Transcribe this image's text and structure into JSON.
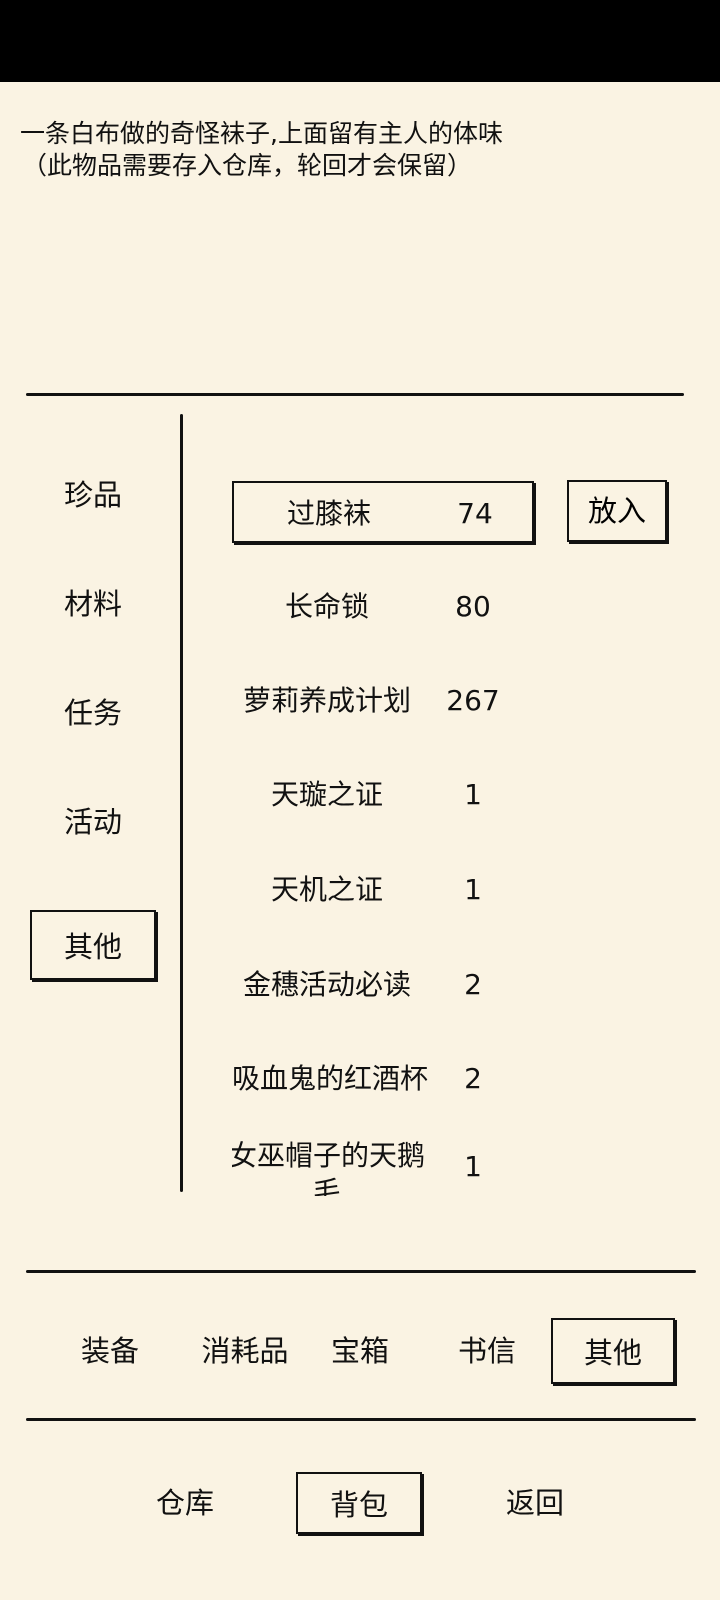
{
  "description": {
    "line1": "一条白布做的奇怪袜子,上面留有主人的体味",
    "line2": "（此物品需要存入仓库，轮回才会保留）"
  },
  "categories": [
    {
      "label": "珍品",
      "selected": false
    },
    {
      "label": "材料",
      "selected": false
    },
    {
      "label": "任务",
      "selected": false
    },
    {
      "label": "活动",
      "selected": false
    },
    {
      "label": "其他",
      "selected": true
    }
  ],
  "items": [
    {
      "name": "过膝袜",
      "count": "74",
      "selected": true
    },
    {
      "name": "长命锁",
      "count": "80",
      "selected": false
    },
    {
      "name": "萝莉养成计划",
      "count": "267",
      "selected": false
    },
    {
      "name": "天璇之证",
      "count": "1",
      "selected": false
    },
    {
      "name": "天机之证",
      "count": "1",
      "selected": false
    },
    {
      "name": "金穗活动必读",
      "count": "2",
      "selected": false
    },
    {
      "name": "吸血鬼的红酒杯",
      "count": "2",
      "selected": false
    },
    {
      "name": "女巫帽子的天鹅毛",
      "count": "1",
      "selected": false
    }
  ],
  "put_button": "放入",
  "tabs": [
    {
      "label": "装备",
      "selected": false
    },
    {
      "label": "消耗品",
      "selected": false
    },
    {
      "label": "宝箱",
      "selected": false
    },
    {
      "label": "书信",
      "selected": false
    },
    {
      "label": "其他",
      "selected": true
    }
  ],
  "nav": [
    {
      "label": "仓库",
      "selected": false
    },
    {
      "label": "背包",
      "selected": true
    },
    {
      "label": "返回",
      "selected": false
    }
  ]
}
